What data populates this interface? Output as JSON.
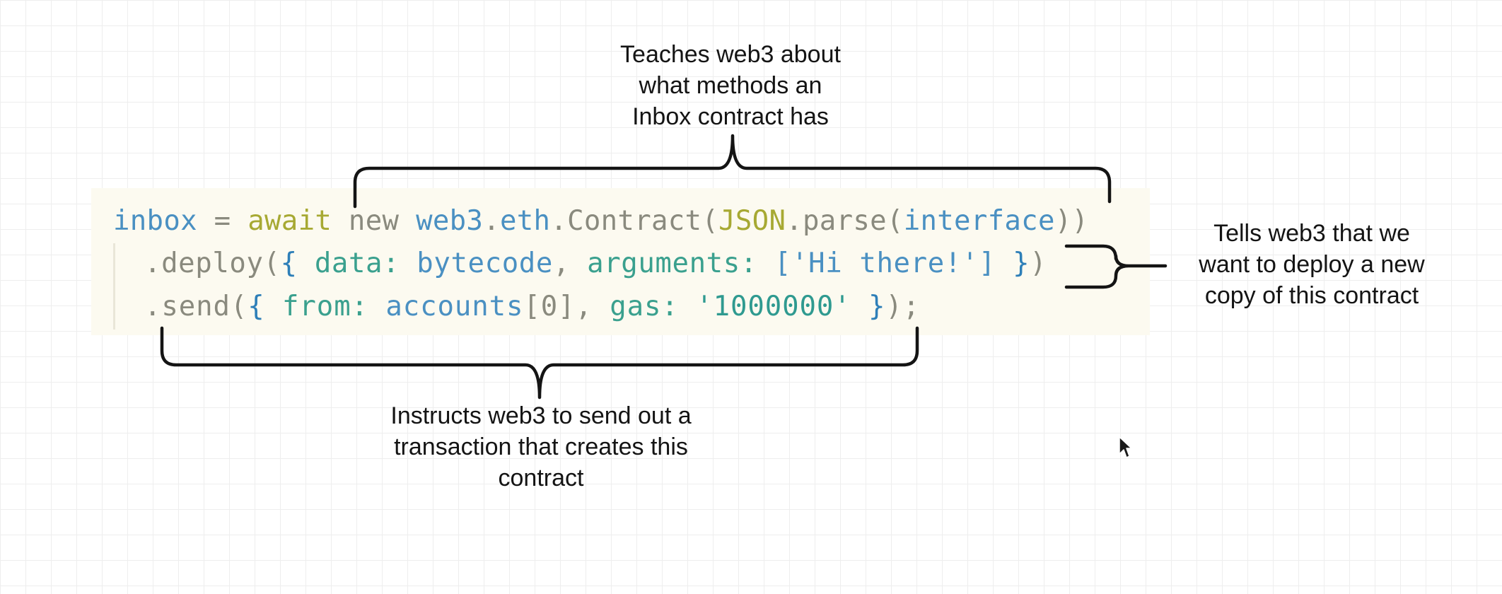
{
  "code": {
    "line1": [
      {
        "t": "inbox",
        "c": "var"
      },
      {
        "t": " = ",
        "c": "op"
      },
      {
        "t": "await",
        "c": "kw"
      },
      {
        "t": " new ",
        "c": "plain"
      },
      {
        "t": "web3",
        "c": "var"
      },
      {
        "t": ".",
        "c": "plain"
      },
      {
        "t": "eth",
        "c": "var"
      },
      {
        "t": ".Contract(",
        "c": "plain"
      },
      {
        "t": "JSON",
        "c": "kw"
      },
      {
        "t": ".parse(",
        "c": "plain"
      },
      {
        "t": "interface",
        "c": "var"
      },
      {
        "t": "))",
        "c": "plain"
      }
    ],
    "line2": [
      {
        "t": ".deploy(",
        "c": "plain"
      },
      {
        "t": "{",
        "c": "brace"
      },
      {
        "t": " data: ",
        "c": "prop"
      },
      {
        "t": "bytecode",
        "c": "var"
      },
      {
        "t": ", ",
        "c": "plain"
      },
      {
        "t": "arguments: ",
        "c": "prop"
      },
      {
        "t": "['Hi there!']",
        "c": "var"
      },
      {
        "t": " }",
        "c": "brace"
      },
      {
        "t": ")",
        "c": "plain"
      }
    ],
    "line3": [
      {
        "t": ".send(",
        "c": "plain"
      },
      {
        "t": "{",
        "c": "brace"
      },
      {
        "t": " from: ",
        "c": "prop"
      },
      {
        "t": "accounts",
        "c": "var"
      },
      {
        "t": "[0]",
        "c": "num"
      },
      {
        "t": ", ",
        "c": "plain"
      },
      {
        "t": "gas: ",
        "c": "prop"
      },
      {
        "t": "'1000000'",
        "c": "str"
      },
      {
        "t": " }",
        "c": "brace"
      },
      {
        "t": ");",
        "c": "plain"
      }
    ]
  },
  "annotations": {
    "top": {
      "lines": [
        "Teaches web3 about",
        "what methods an",
        "Inbox contract has"
      ]
    },
    "right": {
      "lines": [
        "Tells web3 that we",
        "want to deploy a new",
        "copy of this contract"
      ]
    },
    "bottom": {
      "lines": [
        "Instructs web3 to send out a",
        "transaction that creates this",
        "contract"
      ]
    }
  },
  "colors": {
    "code_background": "#fcfaf0",
    "brace_stroke": "#141414",
    "grid_line": "#eeeeee"
  }
}
